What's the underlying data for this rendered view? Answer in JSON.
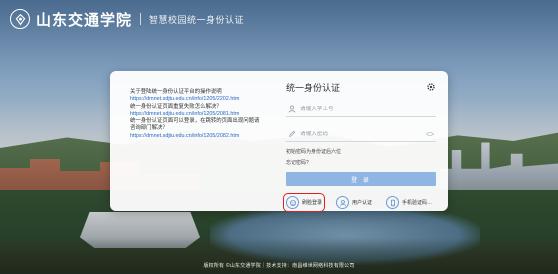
{
  "header": {
    "logo_text": "山东交通学院",
    "subtitle": "智慧校园统一身份认证"
  },
  "notice": {
    "lines": [
      {
        "text": "关于登陆统一身份认证平台的操作说明",
        "link": false
      },
      {
        "text": "https://dmnet.sdjtu.edu.cn/info/1205/2202.htm",
        "link": true
      },
      {
        "text": "统一身份认证页面重复失败怎么解决？",
        "link": false
      },
      {
        "text": "https://dmnet.sdjtu.edu.cn/info/1205/2081.htm",
        "link": true
      },
      {
        "text": "统一身份认证页面可以登录，在跳转的页面出现问题请",
        "link": false
      },
      {
        "text": "咨询部门解决？",
        "link": false
      },
      {
        "text": "https://dmnet.sdjtu.edu.cn/info/1205/2082.htm",
        "link": true
      }
    ]
  },
  "login": {
    "title": "统一身份认证",
    "username_placeholder": "请输入学工号",
    "password_placeholder": "请输入密码",
    "option_line": "初始密码为身份证后六位",
    "forgot": "忘记密码?",
    "submit": "登 录",
    "alternatives": [
      {
        "icon": "face-icon",
        "label": "刷脸登录",
        "highlighted": true
      },
      {
        "icon": "user-icon",
        "label": "用户认证",
        "highlighted": false
      },
      {
        "icon": "phone-icon",
        "label": "手机验证码…",
        "highlighted": false
      }
    ]
  },
  "footer": {
    "text": "版权所有 ©山东交通学院｜技术支持：南昌维世网络科技有限公司"
  },
  "colors": {
    "button": "#8fb6e3",
    "link": "#2b66c4",
    "highlight": "#e02020"
  }
}
